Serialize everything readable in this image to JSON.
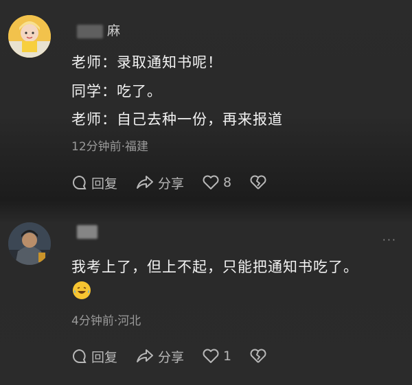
{
  "comments": [
    {
      "username": "麻",
      "lines": [
        "老师：录取通知书呢！",
        "同学：吃了。",
        "老师：自己去种一份，再来报道"
      ],
      "meta": "12分钟前·福建",
      "reply_label": "回复",
      "share_label": "分享",
      "like_count": "8"
    },
    {
      "username": "",
      "lines": [
        "我考上了，但上不起，只能把通知书吃了。"
      ],
      "meta": "4分钟前·河北",
      "reply_label": "回复",
      "share_label": "分享",
      "like_count": "1",
      "more": "···",
      "emoji": "laughing-crying-emoji"
    }
  ],
  "colors": {
    "text": "#f2f2f2",
    "meta": "#9a9a9a",
    "action": "#b8b8b8"
  }
}
